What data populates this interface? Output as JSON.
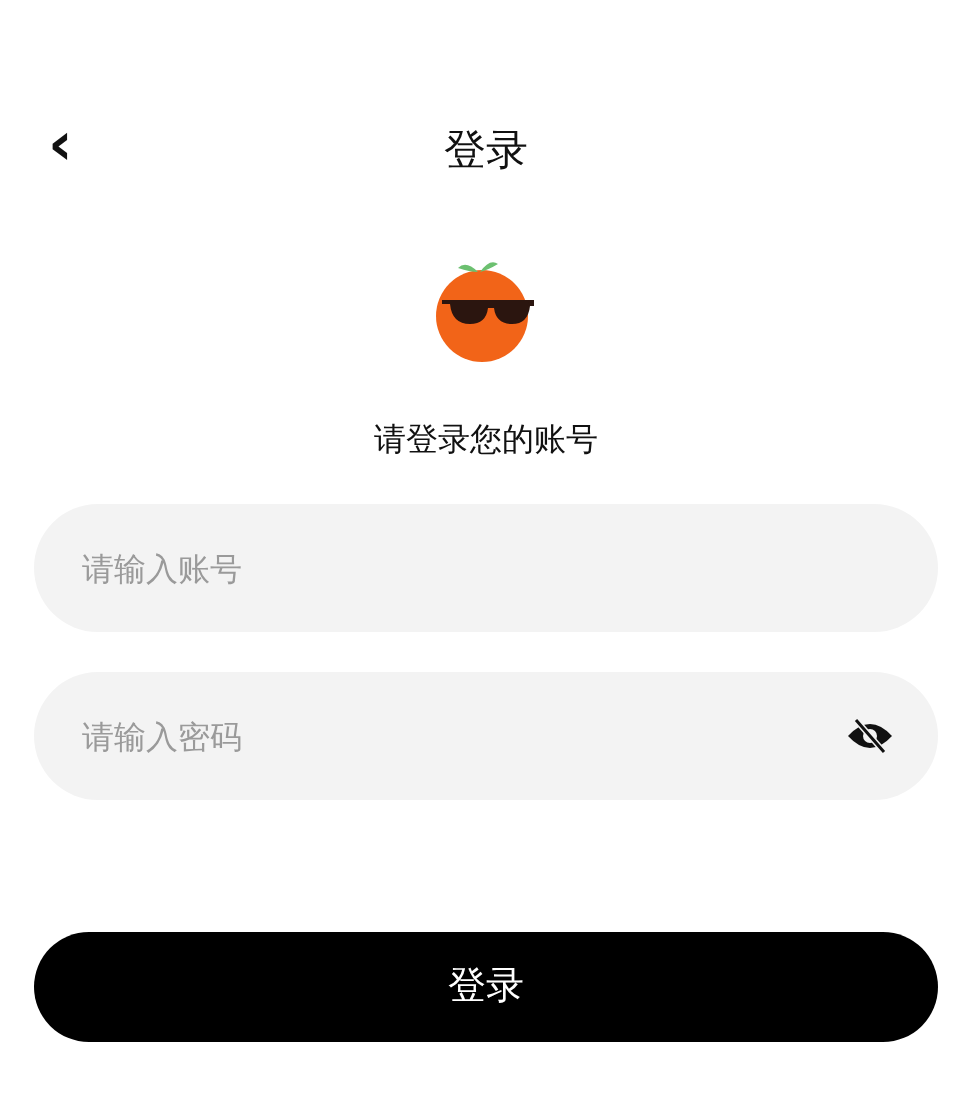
{
  "header": {
    "back": "‹",
    "title": "登录"
  },
  "subtitle": "请登录您的账号",
  "fields": [
    {
      "kind": "text",
      "placeholder": "请输入账号"
    },
    {
      "kind": "password",
      "placeholder": "请输入密码"
    }
  ],
  "submit": "登录"
}
